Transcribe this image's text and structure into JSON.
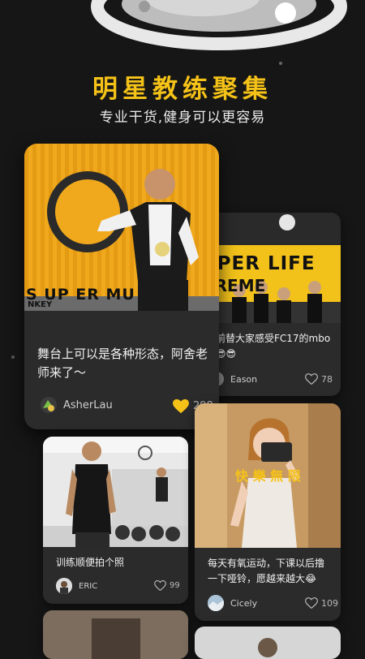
{
  "hero": {
    "title": "明星教练聚集",
    "subtitle": "专业干货,健身可以更容易"
  },
  "colors": {
    "accent": "#f5c218",
    "background": "#161616",
    "card": "#2b2b2b"
  },
  "posts": [
    {
      "caption": "舞台上可以是各种形态，阿舍老师来了～",
      "author": "AsherLau",
      "likes": "298",
      "liked": true,
      "photo_text": "S UP ER MU",
      "photo_text2": "NKEY"
    },
    {
      "caption": "前替大家感受FC17的mbo😎😎",
      "author": "Eason",
      "likes": "78",
      "liked": false,
      "photo_text": "UPER LIFE",
      "photo_text2": "PREME"
    },
    {
      "caption": "训练顺便拍个照",
      "author": "ERIC",
      "likes": "99",
      "liked": false
    },
    {
      "caption": "每天有氧运动，下课以后撸一下哑铃，愿越来越大😂",
      "author": "Cicely",
      "likes": "109",
      "liked": false,
      "photo_text": "快 樂 無 限"
    }
  ]
}
